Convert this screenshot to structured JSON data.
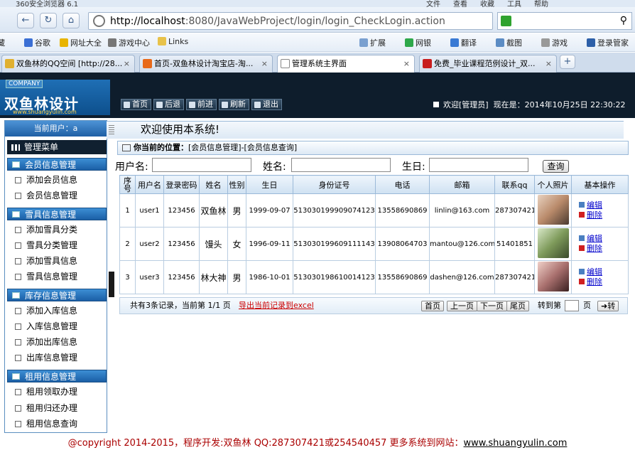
{
  "browser": {
    "title": "360安全浏览器 6.1",
    "menu": [
      "文件",
      "查看",
      "收藏",
      "工具",
      "帮助"
    ],
    "url_host": "http://localhost",
    "url_rest": ":8080/JavaWebProject/login/login_CheckLogin.action",
    "favorites": [
      "藏",
      "谷歌",
      "网址大全",
      "游戏中心",
      "Links",
      "扩展",
      "网银",
      "翻译",
      "截图",
      "游戏",
      "登录管家"
    ],
    "tabs": [
      {
        "label": "双鱼林的QQ空间 [http://28...",
        "active": false
      },
      {
        "label": "首页-双鱼林设计淘宝店-淘...",
        "active": false
      },
      {
        "label": "管理系统主界面",
        "active": true
      },
      {
        "label": "免费_毕业课程范例设计_双...",
        "active": false
      }
    ]
  },
  "header": {
    "company": "COMPANY",
    "logo_name": "双鱼林设计",
    "logo_url": "www.shuangyulin.com",
    "buttons": [
      "首页",
      "后退",
      "前进",
      "刷新",
      "退出"
    ],
    "welcome": "欢迎[管理员]",
    "now": "现在是：2014年10月25日 22:30:22"
  },
  "sidebar": {
    "current_user": "当前用户：a",
    "menu_title": "管理菜单",
    "groups": [
      {
        "title": "会员信息管理",
        "items": [
          "添加会员信息",
          "会员信息管理"
        ]
      },
      {
        "title": "雪具信息管理",
        "items": [
          "添加雪具分类",
          "雪具分类管理",
          "添加雪具信息",
          "雪具信息管理"
        ]
      },
      {
        "title": "库存信息管理",
        "items": [
          "添加入库信息",
          "入库信息管理",
          "添加出库信息",
          "出库信息管理"
        ]
      },
      {
        "title": "租用信息管理",
        "items": [
          "租用领取办理",
          "租用归还办理",
          "租用信息查询"
        ]
      }
    ]
  },
  "main": {
    "welcome": "欢迎使用本系统!",
    "location_label": "你当前的位置：",
    "location": "[会员信息管理]-[会员信息查询]",
    "filters": {
      "username_label": "用户名:",
      "name_label": "姓名:",
      "birthday_label": "生日:",
      "query_button": "查询"
    },
    "table": {
      "headers": [
        "序号",
        "用户名",
        "登录密码",
        "姓名",
        "性别",
        "生日",
        "身份证号",
        "电话",
        "邮箱",
        "联系qq",
        "个人照片",
        "基本操作"
      ],
      "rows": [
        {
          "no": "1",
          "username": "user1",
          "password": "123456",
          "name": "双鱼林",
          "gender": "男",
          "birthday": "1999-09-07",
          "id_card": "513030199909074123",
          "phone": "13558690869",
          "email": "linlin@163.com",
          "qq": "287307421",
          "photo_color": "#b98a6a"
        },
        {
          "no": "2",
          "username": "user2",
          "password": "123456",
          "name": "馒头",
          "gender": "女",
          "birthday": "1996-09-11",
          "id_card": "513030199609111143",
          "phone": "13908064703",
          "email": "mantou@126.com",
          "qq": "51401851",
          "photo_color": "#7e9a5a"
        },
        {
          "no": "3",
          "username": "user3",
          "password": "123456",
          "name": "林大神",
          "gender": "男",
          "birthday": "1986-10-01",
          "id_card": "513030198610014123",
          "phone": "13558690869",
          "email": "dashen@126.com",
          "qq": "287307421",
          "photo_color": "#a9706e"
        }
      ],
      "edit_label": "编辑",
      "delete_label": "删除"
    },
    "pager": {
      "info": "共有3条记录，当前第 1/1 页",
      "export": "导出当前记录到excel",
      "first": "首页",
      "prev": "上一页",
      "next": "下一页",
      "last": "尾页",
      "goto_label": "转到第",
      "page_unit": "页",
      "go": "转"
    }
  },
  "footer": {
    "text": "@copyright 2014-2015，程序开发:双鱼林  QQ:287307421或254540457  更多系统到网站：",
    "link": "www.shuangyulin.com"
  },
  "colors": {
    "header_bg": "#0e1d2c",
    "menu_blue": "#1f5fa4",
    "link": "#0000cc",
    "footer_red": "#a00000"
  }
}
